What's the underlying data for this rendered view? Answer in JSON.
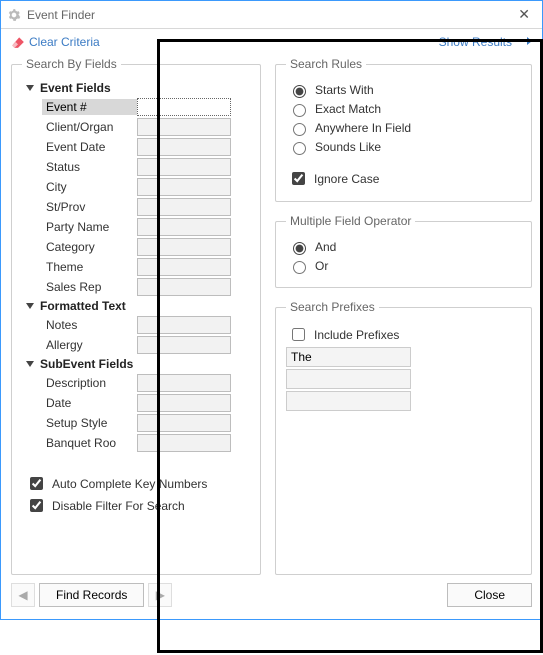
{
  "window": {
    "title": "Event Finder"
  },
  "toolbar": {
    "clear_label": "Clear Criteria",
    "show_results_label": "Show Results"
  },
  "fields_box": {
    "legend": "Search By Fields",
    "groups": [
      {
        "label": "Event Fields",
        "rows": [
          {
            "label": "Event #",
            "selected": true,
            "active": true
          },
          {
            "label": "Client/Organ"
          },
          {
            "label": "Event Date"
          },
          {
            "label": "Status"
          },
          {
            "label": "City"
          },
          {
            "label": "St/Prov"
          },
          {
            "label": "Party Name"
          },
          {
            "label": "Category"
          },
          {
            "label": "Theme"
          },
          {
            "label": "Sales Rep"
          }
        ]
      },
      {
        "label": "Formatted Text",
        "rows": [
          {
            "label": "Notes"
          },
          {
            "label": "Allergy"
          }
        ]
      },
      {
        "label": "SubEvent Fields",
        "rows": [
          {
            "label": "Description"
          },
          {
            "label": "Date"
          },
          {
            "label": "Setup Style"
          },
          {
            "label": "Banquet Roo"
          }
        ]
      }
    ],
    "auto_complete_label": "Auto Complete Key Numbers",
    "auto_complete_checked": true,
    "disable_filter_label": "Disable Filter For Search",
    "disable_filter_checked": true
  },
  "rules": {
    "legend": "Search Rules",
    "options": [
      {
        "label": "Starts With",
        "checked": true
      },
      {
        "label": "Exact Match",
        "checked": false
      },
      {
        "label": "Anywhere In Field",
        "checked": false
      },
      {
        "label": "Sounds Like",
        "checked": false
      }
    ],
    "ignore_case_label": "Ignore Case",
    "ignore_case_checked": true
  },
  "mfo": {
    "legend": "Multiple Field Operator",
    "options": [
      {
        "label": "And",
        "checked": true
      },
      {
        "label": "Or",
        "checked": false
      }
    ]
  },
  "prefixes": {
    "legend": "Search Prefixes",
    "include_label": "Include Prefixes",
    "include_checked": false,
    "values": [
      "The",
      "",
      ""
    ]
  },
  "footer": {
    "find_label": "Find Records",
    "close_label": "Close"
  }
}
